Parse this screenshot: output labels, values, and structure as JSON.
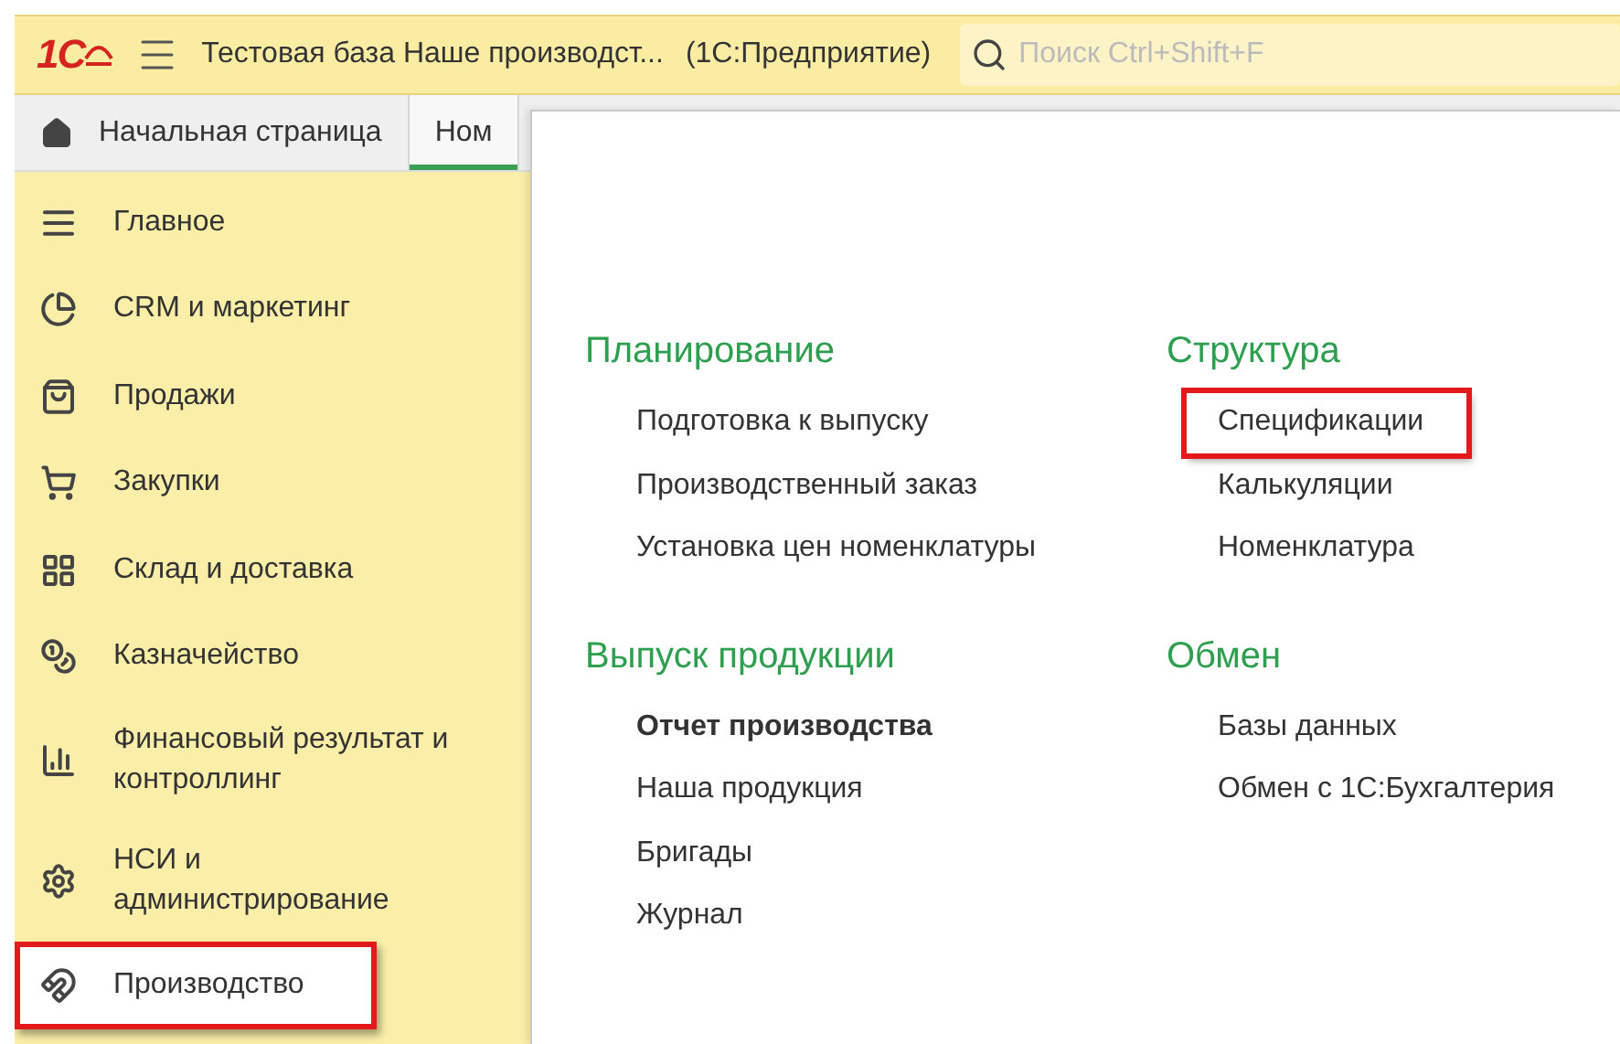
{
  "window": {
    "logo": "1С",
    "title": "Тестовая база Наше производст...",
    "app": "(1С:Предприятие)"
  },
  "search": {
    "placeholder": "Поиск Ctrl+Shift+F"
  },
  "tabs": [
    {
      "label": "Начальная страница",
      "kind": "home",
      "selected": false
    },
    {
      "label": "Ном",
      "kind": "plain",
      "selected": true
    }
  ],
  "sidebar": {
    "items": [
      {
        "label": "Главное",
        "kind": "list",
        "selected": false,
        "annotated": false
      },
      {
        "label": "CRM и маркетинг",
        "kind": "pie",
        "selected": false,
        "annotated": false
      },
      {
        "label": "Продажи",
        "kind": "bag",
        "selected": false,
        "annotated": false
      },
      {
        "label": "Закупки",
        "kind": "cart",
        "selected": false,
        "annotated": false
      },
      {
        "label": "Склад и доставка",
        "kind": "grid",
        "selected": false,
        "annotated": false
      },
      {
        "label": "Казначейство",
        "kind": "coins",
        "selected": false,
        "annotated": false
      },
      {
        "label": "Финансовый результат и контроллинг",
        "kind": "chart",
        "selected": false,
        "annotated": false
      },
      {
        "label": "НСИ и администрирование",
        "kind": "gear",
        "selected": false,
        "annotated": false
      },
      {
        "label": "Производство",
        "kind": "magnet",
        "selected": true,
        "annotated": true
      }
    ]
  },
  "panel": {
    "sections": [
      {
        "title": "Планирование",
        "items": [
          {
            "label": "Подготовка к выпуску",
            "bold": false,
            "annotated": false
          },
          {
            "label": "Производственный заказ",
            "bold": false,
            "annotated": false
          },
          {
            "label": "Установка цен номенклатуры",
            "bold": false,
            "annotated": false
          }
        ]
      },
      {
        "title": "Структура",
        "items": [
          {
            "label": "Спецификации",
            "bold": false,
            "annotated": true
          },
          {
            "label": "Калькуляции",
            "bold": false,
            "annotated": false
          },
          {
            "label": "Номенклатура",
            "bold": false,
            "annotated": false
          }
        ]
      },
      {
        "title": "Выпуск продукции",
        "items": [
          {
            "label": "Отчет производства",
            "bold": true,
            "annotated": false
          },
          {
            "label": "Наша продукция",
            "bold": false,
            "annotated": false
          },
          {
            "label": "Бригады",
            "bold": false,
            "annotated": false
          },
          {
            "label": "Журнал",
            "bold": false,
            "annotated": false
          }
        ]
      },
      {
        "title": "Обмен",
        "items": [
          {
            "label": "Базы данных",
            "bold": false,
            "annotated": false
          },
          {
            "label": "Обмен с 1С:Бухгалтерия",
            "bold": false,
            "annotated": false
          }
        ]
      }
    ]
  }
}
